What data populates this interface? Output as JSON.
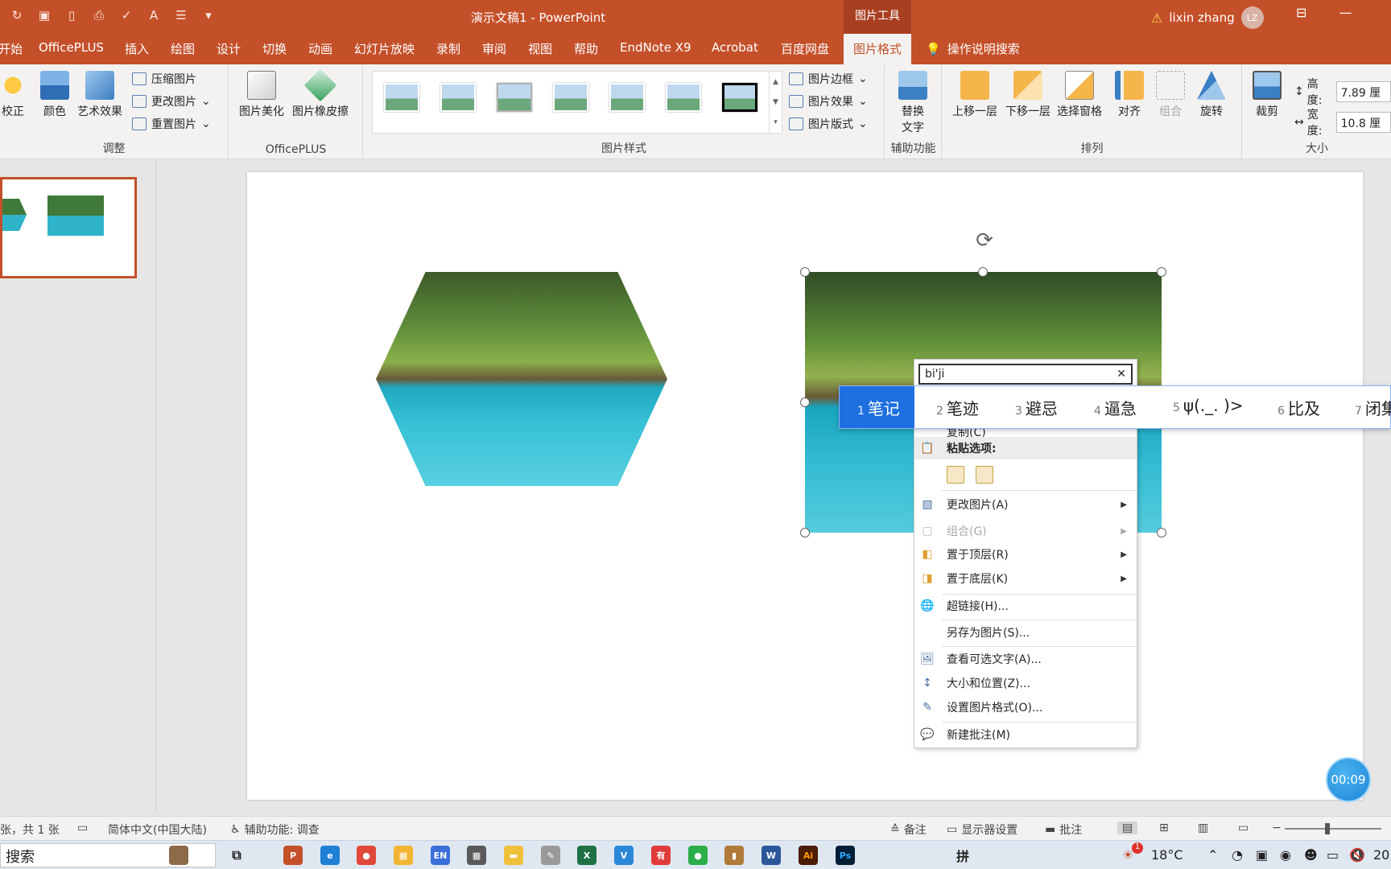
{
  "window": {
    "title": "演示文稿1  -  PowerPoint",
    "context_tab_group": "图片工具",
    "user_name": "lixin zhang",
    "user_initials": "LZ"
  },
  "tabs": [
    {
      "label": "开始"
    },
    {
      "label": "OfficePLUS"
    },
    {
      "label": "插入"
    },
    {
      "label": "绘图"
    },
    {
      "label": "设计"
    },
    {
      "label": "切换"
    },
    {
      "label": "动画"
    },
    {
      "label": "幻灯片放映"
    },
    {
      "label": "录制"
    },
    {
      "label": "审阅"
    },
    {
      "label": "视图"
    },
    {
      "label": "帮助"
    },
    {
      "label": "EndNote X9"
    },
    {
      "label": "Acrobat"
    },
    {
      "label": "百度网盘"
    },
    {
      "label": "图片格式",
      "active": true
    }
  ],
  "tell_me": "操作说明搜索",
  "ribbon": {
    "adjust": {
      "group_label": "调整",
      "corrections": "校正",
      "color": "颜色",
      "artistic": "艺术效果",
      "compress": "压缩图片",
      "change_picture": "更改图片",
      "reset_picture": "重置图片"
    },
    "officeplus": {
      "group_label": "OfficePLUS",
      "beautify": "图片美化",
      "eraser": "图片橡皮擦"
    },
    "styles": {
      "group_label": "图片样式",
      "border": "图片边框",
      "effects": "图片效果",
      "layout": "图片版式"
    },
    "accessibility": {
      "group_label": "辅助功能",
      "alt_text_line1": "替换",
      "alt_text_line2": "文字"
    },
    "arrange": {
      "group_label": "排列",
      "bring_forward": "上移一层",
      "send_backward": "下移一层",
      "selection_pane": "选择窗格",
      "align": "对齐",
      "group": "组合",
      "rotate": "旋转"
    },
    "size": {
      "group_label": "大小",
      "crop": "裁剪",
      "height_label": "高度:",
      "height_value": "7.89 厘",
      "width_label": "宽度:",
      "width_value": "10.8 厘"
    }
  },
  "context_menu": {
    "input_value": "bi'ji",
    "items": {
      "copy_partial": "复制(C)",
      "paste_header": "粘贴选项:",
      "change_picture": "更改图片(A)",
      "group": "组合(G)",
      "bring_front": "置于顶层(R)",
      "send_back": "置于底层(K)",
      "hyperlink": "超链接(H)...",
      "save_as_picture": "另存为图片(S)...",
      "alt_text": "查看可选文字(A)...",
      "size_position": "大小和位置(Z)...",
      "format_picture": "设置图片格式(O)...",
      "new_comment": "新建批注(M)"
    }
  },
  "ime_candidates": [
    {
      "num": "1",
      "text": "笔记"
    },
    {
      "num": "2",
      "text": "笔迹"
    },
    {
      "num": "3",
      "text": "避忌"
    },
    {
      "num": "4",
      "text": "逼急"
    },
    {
      "num": "5",
      "text": "ψ(._. )>"
    },
    {
      "num": "6",
      "text": "比及"
    },
    {
      "num": "7",
      "text": "闭集"
    }
  ],
  "timer": "00:09",
  "status": {
    "slide_count": "张，共 1 张",
    "language": "简体中文(中国大陆)",
    "accessibility": "辅助功能: 调查",
    "notes": "备注",
    "display_settings": "显示器设置",
    "comments": "批注"
  },
  "taskbar": {
    "search_placeholder": "搜索",
    "temperature": "18°C",
    "badge_count": "1",
    "clock_partial": "20"
  },
  "colors": {
    "accent": "#c4502a",
    "ime_selected": "#1e6fe0"
  }
}
